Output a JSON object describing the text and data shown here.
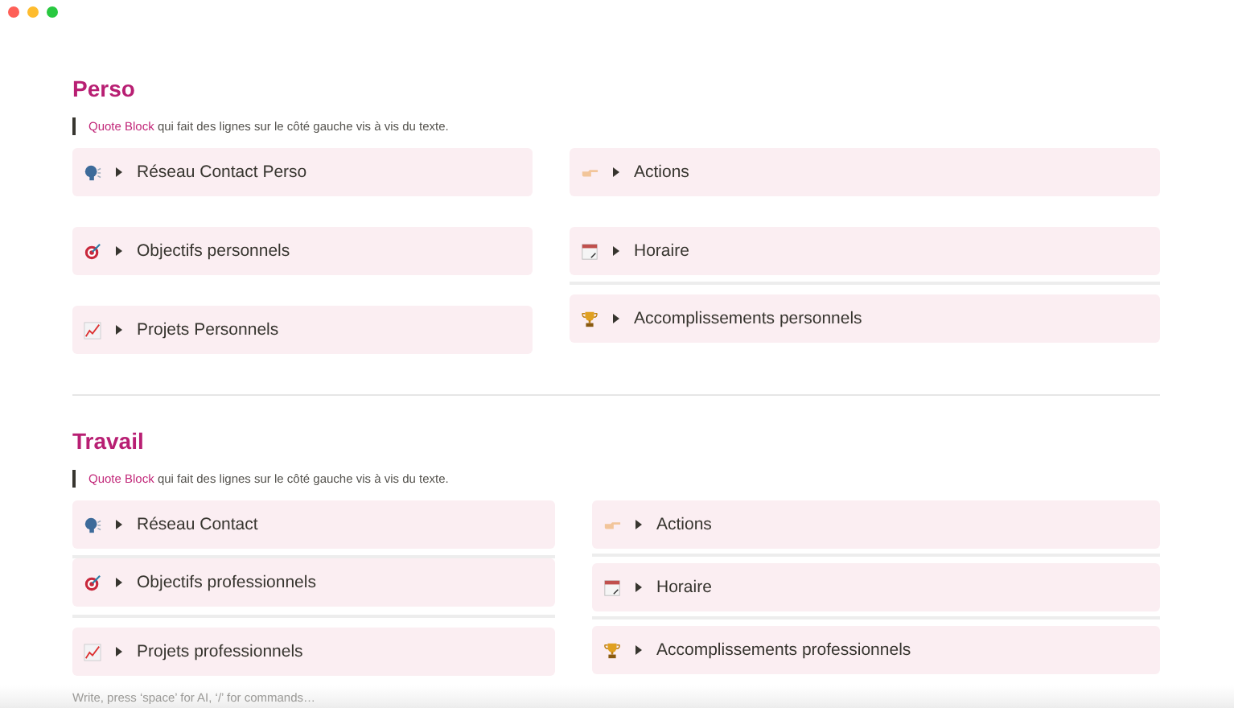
{
  "sections": [
    {
      "title": "Perso",
      "quote": {
        "highlight": "Quote Block",
        "text": "qui fait des lignes sur le côté gauche vis à vis du texte."
      },
      "columns": [
        [
          {
            "label": "Réseau Contact Perso",
            "expanded": false
          },
          {
            "label": "Objectifs personnels",
            "expanded": false
          },
          {
            "label": "Projets Personnels",
            "expanded": false
          }
        ],
        [
          {
            "label": "Actions",
            "expanded": false
          },
          {
            "label": "Horaire",
            "expanded": false
          },
          {
            "label": "Accomplissements personnels",
            "expanded": false
          }
        ]
      ]
    },
    {
      "title": "Travail",
      "quote": {
        "highlight": "Quote Block",
        "text": "qui fait des lignes sur le côté gauche vis à vis du texte."
      },
      "columns": [
        [
          {
            "label": "Réseau Contact",
            "expanded": false
          },
          {
            "label": "Objectifs professionnels",
            "expanded": false
          },
          {
            "label": "Projets professionnels",
            "expanded": false
          }
        ],
        [
          {
            "label": "Actions",
            "expanded": false
          },
          {
            "label": "Horaire",
            "expanded": false
          },
          {
            "label": "Accomplissements professionnels",
            "expanded": false
          }
        ]
      ]
    }
  ],
  "editor": {
    "placeholder": "Write, press ‘space’ for AI, ‘/’ for commands…"
  }
}
